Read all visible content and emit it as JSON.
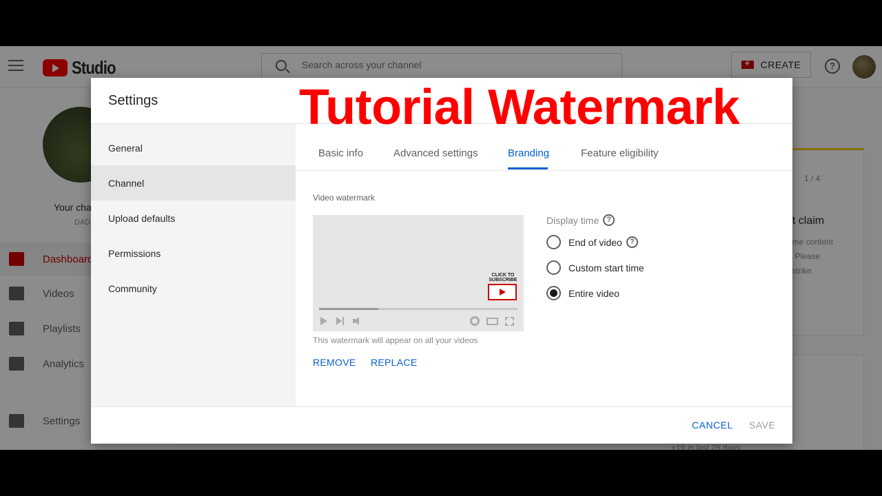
{
  "app": {
    "brand": "Studio"
  },
  "search": {
    "placeholder": "Search across your channel"
  },
  "header": {
    "create_label": "CREATE"
  },
  "leftnav": {
    "channel_name": "Your cha",
    "channel_sub": "DAD",
    "items": [
      {
        "label": "Dashboard",
        "active": true
      },
      {
        "label": "Videos"
      },
      {
        "label": "Playlists"
      },
      {
        "label": "Analytics"
      },
      {
        "label": "Settings"
      }
    ]
  },
  "background": {
    "pager": "1 / 4",
    "claim_title": "ht claim",
    "claim_lines": [
      "ome content",
      ". Please",
      "strike."
    ],
    "footer_stat": "+19 in last 28 days"
  },
  "dialog": {
    "title": "Settings",
    "sidebar": [
      {
        "label": "General"
      },
      {
        "label": "Channel",
        "active": true
      },
      {
        "label": "Upload defaults"
      },
      {
        "label": "Permissions"
      },
      {
        "label": "Community"
      }
    ],
    "tabs": [
      {
        "label": "Basic info"
      },
      {
        "label": "Advanced settings"
      },
      {
        "label": "Branding",
        "active": true
      },
      {
        "label": "Feature eligibility"
      }
    ],
    "watermark": {
      "section_label": "Video watermark",
      "badge_text": "CLICK TO SUBSCRIBE",
      "hint": "This watermark will appear on all your videos",
      "remove_label": "REMOVE",
      "replace_label": "REPLACE"
    },
    "display_time": {
      "label": "Display time",
      "options": [
        {
          "label": "End of video",
          "selected": false
        },
        {
          "label": "Custom start time",
          "selected": false
        },
        {
          "label": "Entire video",
          "selected": true
        }
      ]
    },
    "footer": {
      "cancel_label": "CANCEL",
      "save_label": "SAVE"
    }
  },
  "overlay_title": "Tutorial Watermark",
  "colors": {
    "accent_blue": "#065fd4",
    "brand_red": "#ff0000",
    "overlay_text_red": "#ff0000"
  }
}
